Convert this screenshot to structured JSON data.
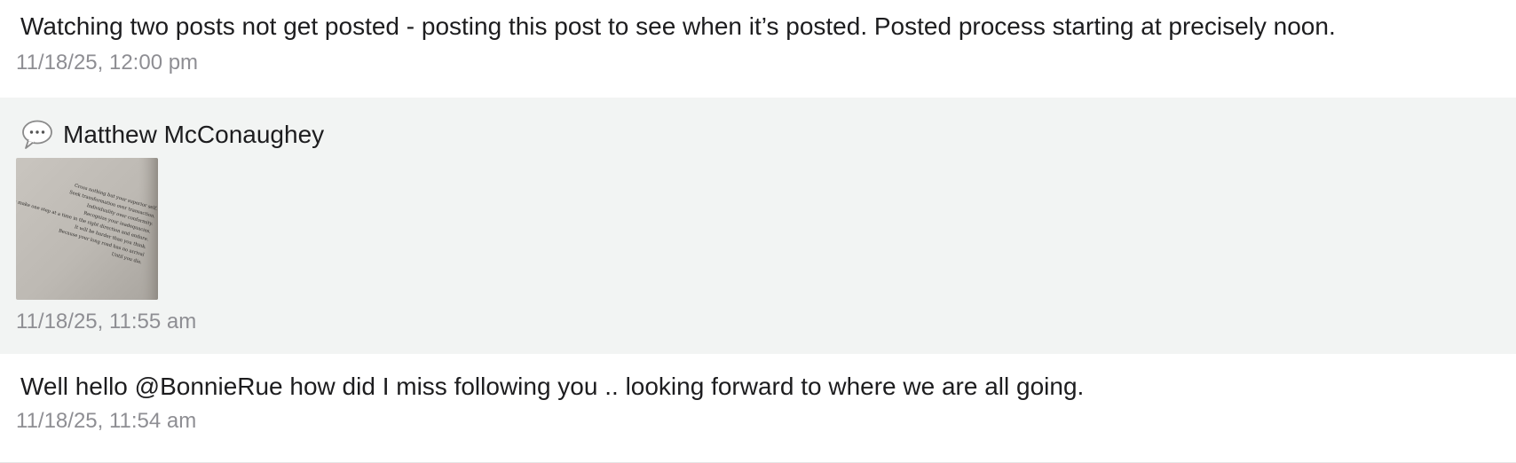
{
  "posts": [
    {
      "text": "Watching two posts not get posted - posting this post to see when it’s posted. Posted process starting at precisely noon.",
      "timestamp": "11/18/25, 12:00 pm"
    },
    {
      "author": "Matthew McConaughey",
      "icon": "speech-bubble-icon",
      "image": {
        "description_icon": "book-page-photo",
        "lines": [
          "Cross nothing but your superior self.",
          "Seek transformation over transaction.",
          "Individuality over conformity.",
          "Recognize your inadequacies.",
          "Then make one step at a time in the right direction and endure.",
          "It will be harder than you think.",
          "Because your long road has no arrival",
          "Until you die."
        ]
      },
      "timestamp": "11/18/25, 11:55 am"
    },
    {
      "text": "Well hello @BonnieRue how did I miss following you .. looking forward to where we are all going.",
      "timestamp": "11/18/25, 11:54 am"
    }
  ],
  "colors": {
    "text": "#1d1d1f",
    "timestamp": "#8e8e93",
    "highlight_bg": "#f2f4f3"
  }
}
